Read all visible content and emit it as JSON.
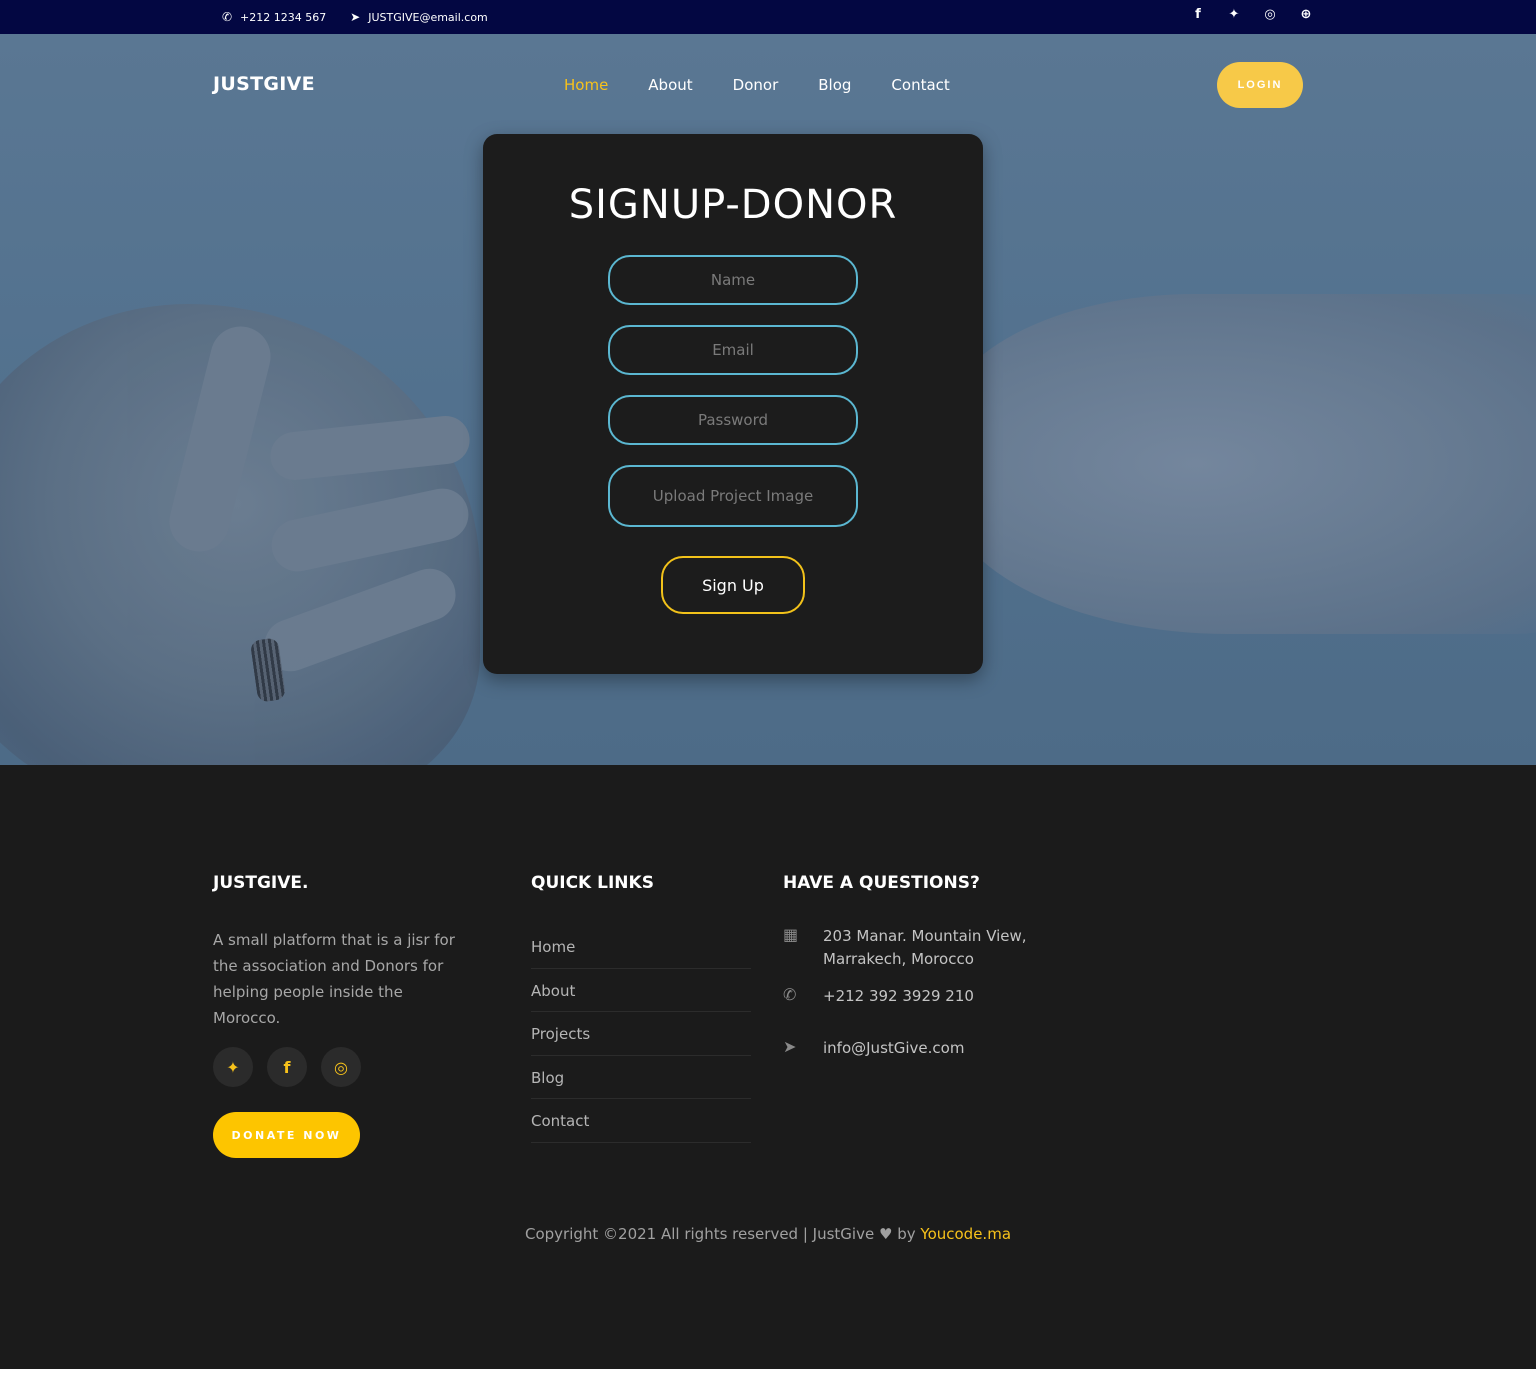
{
  "topbar": {
    "phone": "+212 1234 567",
    "email": "JUSTGIVE@email.com",
    "social": [
      "facebook-icon",
      "twitter-icon",
      "instagram-icon",
      "dribbble-icon"
    ]
  },
  "nav": {
    "brand": "JUSTGIVE",
    "items": [
      "Home",
      "About",
      "Donor",
      "Blog",
      "Contact"
    ],
    "active": "Home",
    "login": "LOGIN"
  },
  "form": {
    "title": "SIGNUP-DONOR",
    "name_placeholder": "Name",
    "email_placeholder": "Email",
    "password_placeholder": "Password",
    "upload_label": "Upload Project Image",
    "submit": "Sign Up"
  },
  "footer": {
    "brand": "JUSTGIVE.",
    "about": "A small platform that is a jisr for the association and Donors for helping people inside the Morocco.",
    "social": [
      "twitter-icon",
      "facebook-icon",
      "instagram-icon"
    ],
    "donate": "DONATE NOW",
    "quick_links_title": "QUICK LINKS",
    "quick_links": [
      "Home",
      "About",
      "Projects",
      "Blog",
      "Contact"
    ],
    "questions_title": "HAVE A QUESTIONS?",
    "address": "203 Manar. Mountain View, Marrakech, Morocco",
    "phone": "+212 392 3929 210",
    "email": "info@JustGive.com",
    "copyright_prefix": "Copyright ©2021 All rights reserved | JustGive",
    "copyright_by": "by",
    "copyright_link": "Youcode.ma"
  },
  "colors": {
    "topbar": "#030742",
    "accent": "#f7c21b",
    "field_border": "#5bb7d1",
    "card": "#1c1c1c",
    "footer": "#1b1b1b"
  }
}
